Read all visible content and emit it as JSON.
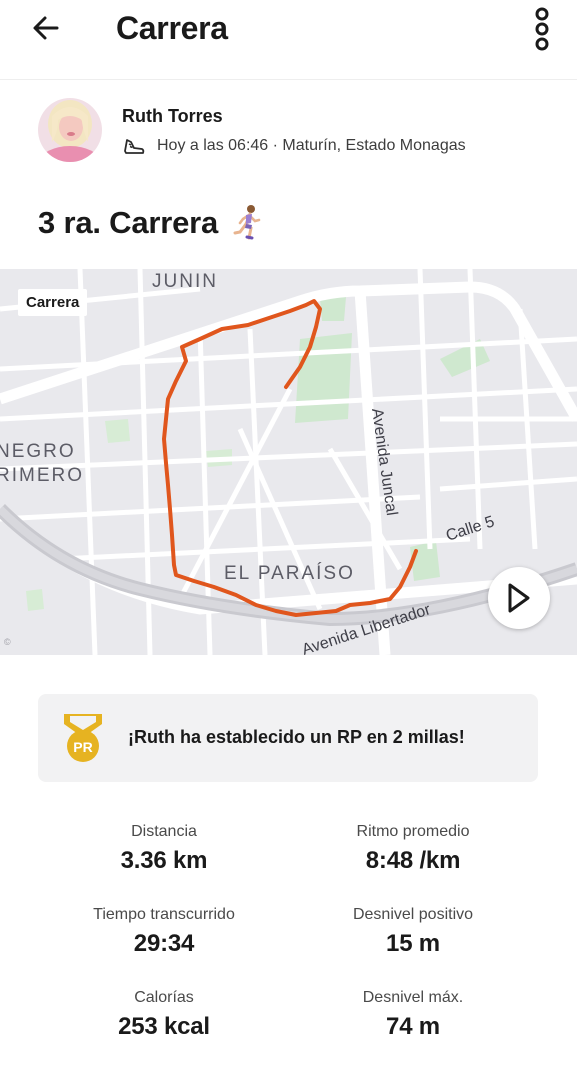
{
  "header": {
    "title": "Carrera",
    "back_icon": "arrow-left-icon",
    "more_icon": "more-vertical-icon"
  },
  "athlete": {
    "name": "Ruth Torres",
    "meta": "Hoy a las 06:46 · Maturín, Estado Monagas",
    "activity_icon": "running-shoe-icon"
  },
  "activity": {
    "title": "3 ra. Carrera",
    "emoji_icon": "woman-running-icon"
  },
  "map": {
    "tag": "Carrera",
    "route_color": "#e0561d",
    "labels": {
      "junin": "JUNIN",
      "negro": "NEGRO",
      "rimero": "RIMERO",
      "juncal": "Avenida Juncal",
      "calle5": "Calle 5",
      "paraiso": "EL PARAÍSO",
      "libertador": "Avenida Libertador"
    },
    "play_icon": "play-icon"
  },
  "pr": {
    "text": "¡Ruth ha establecido un RP en 2 millas!",
    "badge_label": "PR",
    "badge_color": "#e6b321"
  },
  "stats": [
    {
      "label": "Distancia",
      "value": "3.36 km"
    },
    {
      "label": "Ritmo promedio",
      "value": "8:48 /km"
    },
    {
      "label": "Tiempo transcurrido",
      "value": "29:34"
    },
    {
      "label": "Desnivel positivo",
      "value": "15 m"
    },
    {
      "label": "Calorías",
      "value": "253 kcal"
    },
    {
      "label": "Desnivel máx.",
      "value": "74 m"
    }
  ]
}
